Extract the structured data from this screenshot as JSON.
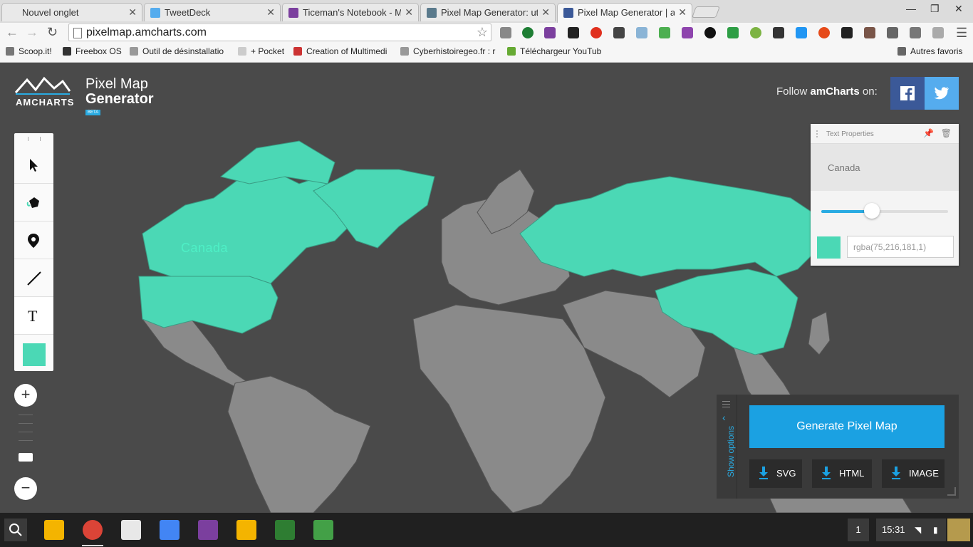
{
  "browser": {
    "tabs": [
      {
        "title": "Nouvel onglet",
        "favicon_color": "#dcdcdc"
      },
      {
        "title": "TweetDeck",
        "favicon_color": "#55acee"
      },
      {
        "title": "Ticeman's Notebook - Mic",
        "favicon_color": "#7b3f9e"
      },
      {
        "title": "Pixel Map Generator: utilis",
        "favicon_color": "#5a7a8c"
      },
      {
        "title": "Pixel Map Generator | am",
        "favicon_color": "#3b5998"
      }
    ],
    "url": "pixelmap.amcharts.com",
    "bookmarks": [
      {
        "label": "Scoop.it!",
        "icon_color": "#777"
      },
      {
        "label": "Freebox OS",
        "icon_color": "#333"
      },
      {
        "label": "Outil de désinstallatio",
        "icon_color": "#999"
      },
      {
        "label": "+ Pocket",
        "icon_color": "#777"
      },
      {
        "label": "Creation of Multimedi",
        "icon_color": "#c33"
      },
      {
        "label": "Cyberhistoiregeo.fr : r",
        "icon_color": "#999"
      },
      {
        "label": "Téléchargeur YouTub",
        "icon_color": "#6a3"
      }
    ],
    "other_bookmarks": "Autres favoris"
  },
  "header": {
    "logo_word": "AMCHARTS",
    "title_line1": "Pixel Map",
    "title_line2": "Generator",
    "badge": "BETA",
    "follow_prefix": "Follow ",
    "follow_brand": "amCharts",
    "follow_suffix": " on:"
  },
  "map": {
    "highlight_color": "#4bd8b5",
    "country_color": "#8a8a8a",
    "label": "Canada"
  },
  "text_properties": {
    "title": "Text Properties",
    "text_value": "Canada",
    "slider_value": 0.4,
    "color_value": "rgba(75,216,181,1)",
    "swatch": "#4bd8b5"
  },
  "export": {
    "show_options": "Show options",
    "generate_label": "Generate Pixel Map",
    "downloads": [
      "SVG",
      "HTML",
      "IMAGE"
    ]
  },
  "taskbar": {
    "notifications": "1",
    "time": "15:31"
  }
}
